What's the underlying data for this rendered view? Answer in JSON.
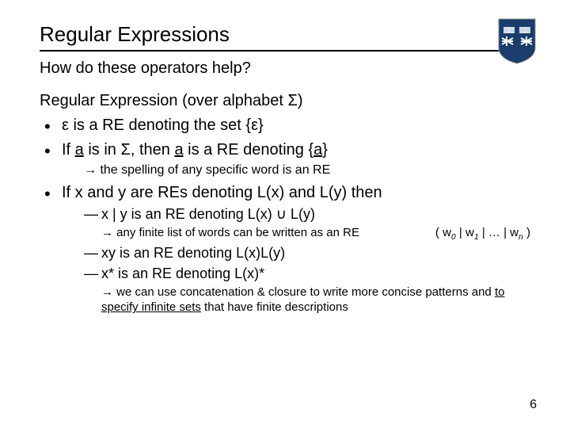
{
  "title": "Regular Expressions",
  "subtitle": "How do these operators help?",
  "section": "Regular Expression (over alphabet Σ)",
  "bullets": {
    "b1": "ε is a RE denoting the set {ε}",
    "b2_pre": "If ",
    "b2_a1": "a",
    "b2_mid1": " is in Σ, then ",
    "b2_a2": "a",
    "b2_mid2": " is a RE denoting {",
    "b2_a3": "a",
    "b2_end": "}",
    "b2_note": "the spelling of any specific word is an RE",
    "b3": "If x and y are REs denoting L(x) and L(y) then",
    "d1": "x | y is an RE denoting L(x) ∪ L(y)",
    "d1_note": "any finite list of words can be written as an RE",
    "d1_ex_open": "( w",
    "d1_ex_s0": "0",
    "d1_ex_bar1": " | w",
    "d1_ex_s1": "1",
    "d1_ex_bar2": " | … | w",
    "d1_ex_sn": "n",
    "d1_ex_close": " )",
    "d2": "xy is an RE denoting L(x)L(y)",
    "d3": "x* is an RE denoting L(x)*",
    "d3_note_a": "we can use concatenation & closure to write more concise patterns and ",
    "d3_note_u": "to specify infinite sets",
    "d3_note_b": " that have finite descriptions"
  },
  "page": "6"
}
